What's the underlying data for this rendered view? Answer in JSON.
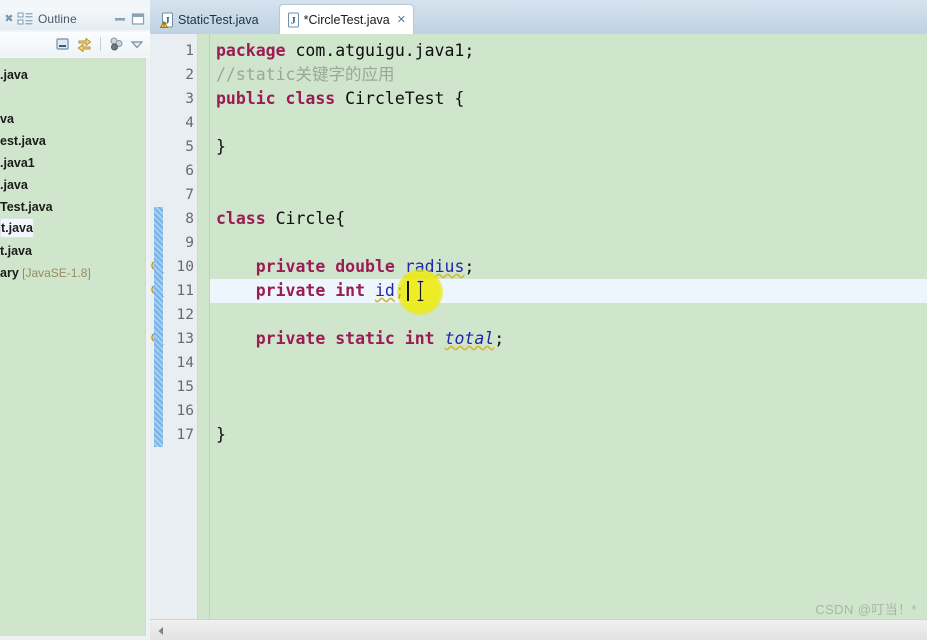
{
  "left_pane": {
    "outline_view": {
      "close_icon": "close-x-icon",
      "view_icon": "outline-view-icon",
      "label": "Outline",
      "minimize_icon": "minimize-icon",
      "maximize_icon": "maximize-icon"
    },
    "outline_toolbar": [
      {
        "icon": "collapse-all-icon"
      },
      {
        "icon": "link-with-editor-icon"
      },
      {
        "icon": "filter-members-icon"
      },
      {
        "icon": "view-menu-chevron-down-icon"
      }
    ],
    "tree_items": [
      {
        "label": ".java",
        "type": "file",
        "truncated": true,
        "selected": false
      },
      {
        "label": "",
        "type": "file",
        "truncated": true,
        "selected": false
      },
      {
        "label": "va",
        "type": "file",
        "truncated": true,
        "selected": false
      },
      {
        "label": "est.java",
        "type": "file",
        "truncated": true,
        "selected": false
      },
      {
        "label": ".java1",
        "type": "package",
        "truncated": true,
        "selected": false
      },
      {
        "label": ".java",
        "type": "file",
        "truncated": true,
        "selected": false
      },
      {
        "label": "Test.java",
        "type": "file",
        "truncated": true,
        "selected": false
      },
      {
        "label": "t.java",
        "type": "file",
        "truncated": true,
        "selected": true
      },
      {
        "label": "t.java",
        "type": "file",
        "truncated": true,
        "selected": false
      },
      {
        "label": "ary",
        "type": "library",
        "truncated": true,
        "selected": false,
        "version": "[JavaSE-1.8]"
      }
    ]
  },
  "editor": {
    "tabs": [
      {
        "title": "StaticTest.java",
        "active": false,
        "dirty": false,
        "icon": "java-file-warning-icon",
        "closable": false
      },
      {
        "title": "*CircleTest.java",
        "active": true,
        "dirty": true,
        "icon": "java-file-icon",
        "closable": true,
        "close_label": "✕"
      }
    ],
    "colors": {
      "background": "#cfe5cc",
      "gutter": "#e9eef2",
      "current_line": "#eef6fd",
      "keyword": "#9b1b55",
      "comment": "#98a89a",
      "field": "#2424a8",
      "static_field": "#2424a8",
      "diff_bar": "#76b3e8",
      "click_highlight": "#ecea18"
    },
    "current_line_number": 11,
    "lines": [
      {
        "n": 1,
        "tokens": [
          {
            "t": "package",
            "c": "kw"
          },
          {
            "t": " com.atguigu.java1;",
            "c": "plain"
          }
        ],
        "warning": false,
        "diff": false
      },
      {
        "n": 2,
        "tokens": [
          {
            "t": "//static关键字的应用",
            "c": "comment"
          }
        ],
        "warning": false,
        "diff": false
      },
      {
        "n": 3,
        "tokens": [
          {
            "t": "public",
            "c": "kw"
          },
          {
            "t": " ",
            "c": "plain"
          },
          {
            "t": "class",
            "c": "kw"
          },
          {
            "t": " CircleTest {",
            "c": "plain"
          }
        ],
        "warning": false,
        "diff": false
      },
      {
        "n": 4,
        "tokens": [],
        "warning": false,
        "diff": false
      },
      {
        "n": 5,
        "tokens": [
          {
            "t": "}",
            "c": "plain"
          }
        ],
        "warning": false,
        "diff": false
      },
      {
        "n": 6,
        "tokens": [],
        "warning": false,
        "diff": false
      },
      {
        "n": 7,
        "tokens": [],
        "warning": false,
        "diff": false
      },
      {
        "n": 8,
        "tokens": [
          {
            "t": "class",
            "c": "kw"
          },
          {
            "t": " Circle{",
            "c": "plain"
          }
        ],
        "warning": false,
        "diff": true
      },
      {
        "n": 9,
        "tokens": [],
        "warning": false,
        "diff": true
      },
      {
        "n": 10,
        "tokens": [
          {
            "t": "    ",
            "c": "plain"
          },
          {
            "t": "private",
            "c": "kw"
          },
          {
            "t": " ",
            "c": "plain"
          },
          {
            "t": "double",
            "c": "kw"
          },
          {
            "t": " ",
            "c": "plain"
          },
          {
            "t": "radius",
            "c": "field-squiggle"
          },
          {
            "t": ";",
            "c": "plain"
          }
        ],
        "warning": true,
        "diff": true
      },
      {
        "n": 11,
        "tokens": [
          {
            "t": "    ",
            "c": "plain"
          },
          {
            "t": "private",
            "c": "kw"
          },
          {
            "t": " ",
            "c": "plain"
          },
          {
            "t": "int",
            "c": "kw"
          },
          {
            "t": " ",
            "c": "plain"
          },
          {
            "t": "id",
            "c": "field-squiggle"
          },
          {
            "t": ";",
            "c": "plain"
          }
        ],
        "warning": true,
        "diff": true
      },
      {
        "n": 12,
        "tokens": [],
        "warning": false,
        "diff": true
      },
      {
        "n": 13,
        "tokens": [
          {
            "t": "    ",
            "c": "plain"
          },
          {
            "t": "private",
            "c": "kw"
          },
          {
            "t": " ",
            "c": "plain"
          },
          {
            "t": "static",
            "c": "kw"
          },
          {
            "t": " ",
            "c": "plain"
          },
          {
            "t": "int",
            "c": "kw"
          },
          {
            "t": " ",
            "c": "plain"
          },
          {
            "t": "total",
            "c": "static-squiggle"
          },
          {
            "t": ";",
            "c": "plain"
          }
        ],
        "warning": true,
        "diff": true
      },
      {
        "n": 14,
        "tokens": [],
        "warning": false,
        "diff": true
      },
      {
        "n": 15,
        "tokens": [],
        "warning": false,
        "diff": true
      },
      {
        "n": 16,
        "tokens": [],
        "warning": false,
        "diff": true
      },
      {
        "n": 17,
        "tokens": [
          {
            "t": "}",
            "c": "plain"
          }
        ],
        "warning": false,
        "diff": true
      }
    ],
    "scrollbar": {
      "left_arrow_icon": "scroll-left-arrow-icon"
    }
  },
  "watermark": {
    "text": "CSDN @叮当！*"
  }
}
